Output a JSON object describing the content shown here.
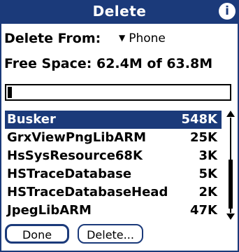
{
  "titlebar": {
    "title": "Delete",
    "info_icon": "i"
  },
  "delete_from": {
    "label": "Delete From:",
    "selected_device": "Phone"
  },
  "free_space": {
    "label": "Free Space: 62.4M of 63.8M",
    "used_fraction": 0.02
  },
  "items": [
    {
      "name": "Busker",
      "size": "548K",
      "selected": true
    },
    {
      "name": "GrxViewPngLibARM",
      "size": "25K",
      "selected": false
    },
    {
      "name": "HsSysResource68K",
      "size": "3K",
      "selected": false
    },
    {
      "name": "HSTraceDatabase",
      "size": "5K",
      "selected": false
    },
    {
      "name": "HSTraceDatabaseHead",
      "size": "2K",
      "selected": false
    },
    {
      "name": "JpegLibARM",
      "size": "47K",
      "selected": false
    }
  ],
  "buttons": {
    "done": "Done",
    "delete": "Delete..."
  },
  "colors": {
    "accent": "#1b3a7a"
  }
}
